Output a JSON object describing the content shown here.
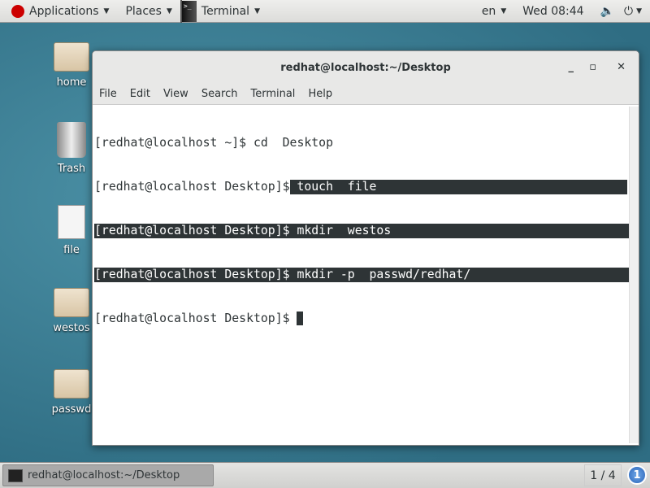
{
  "topbar": {
    "applications": "Applications",
    "places": "Places",
    "app": "Terminal",
    "lang": "en",
    "clock": "Wed 08:44"
  },
  "desktop": {
    "icons": [
      "home",
      "Trash",
      "file",
      "westos",
      "passwd"
    ]
  },
  "window": {
    "title": "redhat@localhost:~/Desktop",
    "menu": [
      "File",
      "Edit",
      "View",
      "Search",
      "Terminal",
      "Help"
    ],
    "lines": [
      {
        "prompt": "[redhat@localhost ~]$ ",
        "cmd": "cd  Desktop"
      },
      {
        "prompt": "[redhat@localhost Desktop]$",
        "cmd": " touch  file"
      },
      {
        "prompt": "[redhat@localhost Desktop]$ ",
        "cmd": "mkdir  westos"
      },
      {
        "prompt": "[redhat@localhost Desktop]$ ",
        "cmd": "mkdir -p  passwd/redhat/"
      },
      {
        "prompt": "[redhat@localhost Desktop]$ ",
        "cmd": ""
      }
    ]
  },
  "taskbar": {
    "task": "redhat@localhost:~/Desktop",
    "pager": "1 / 4",
    "workspace": "1"
  }
}
